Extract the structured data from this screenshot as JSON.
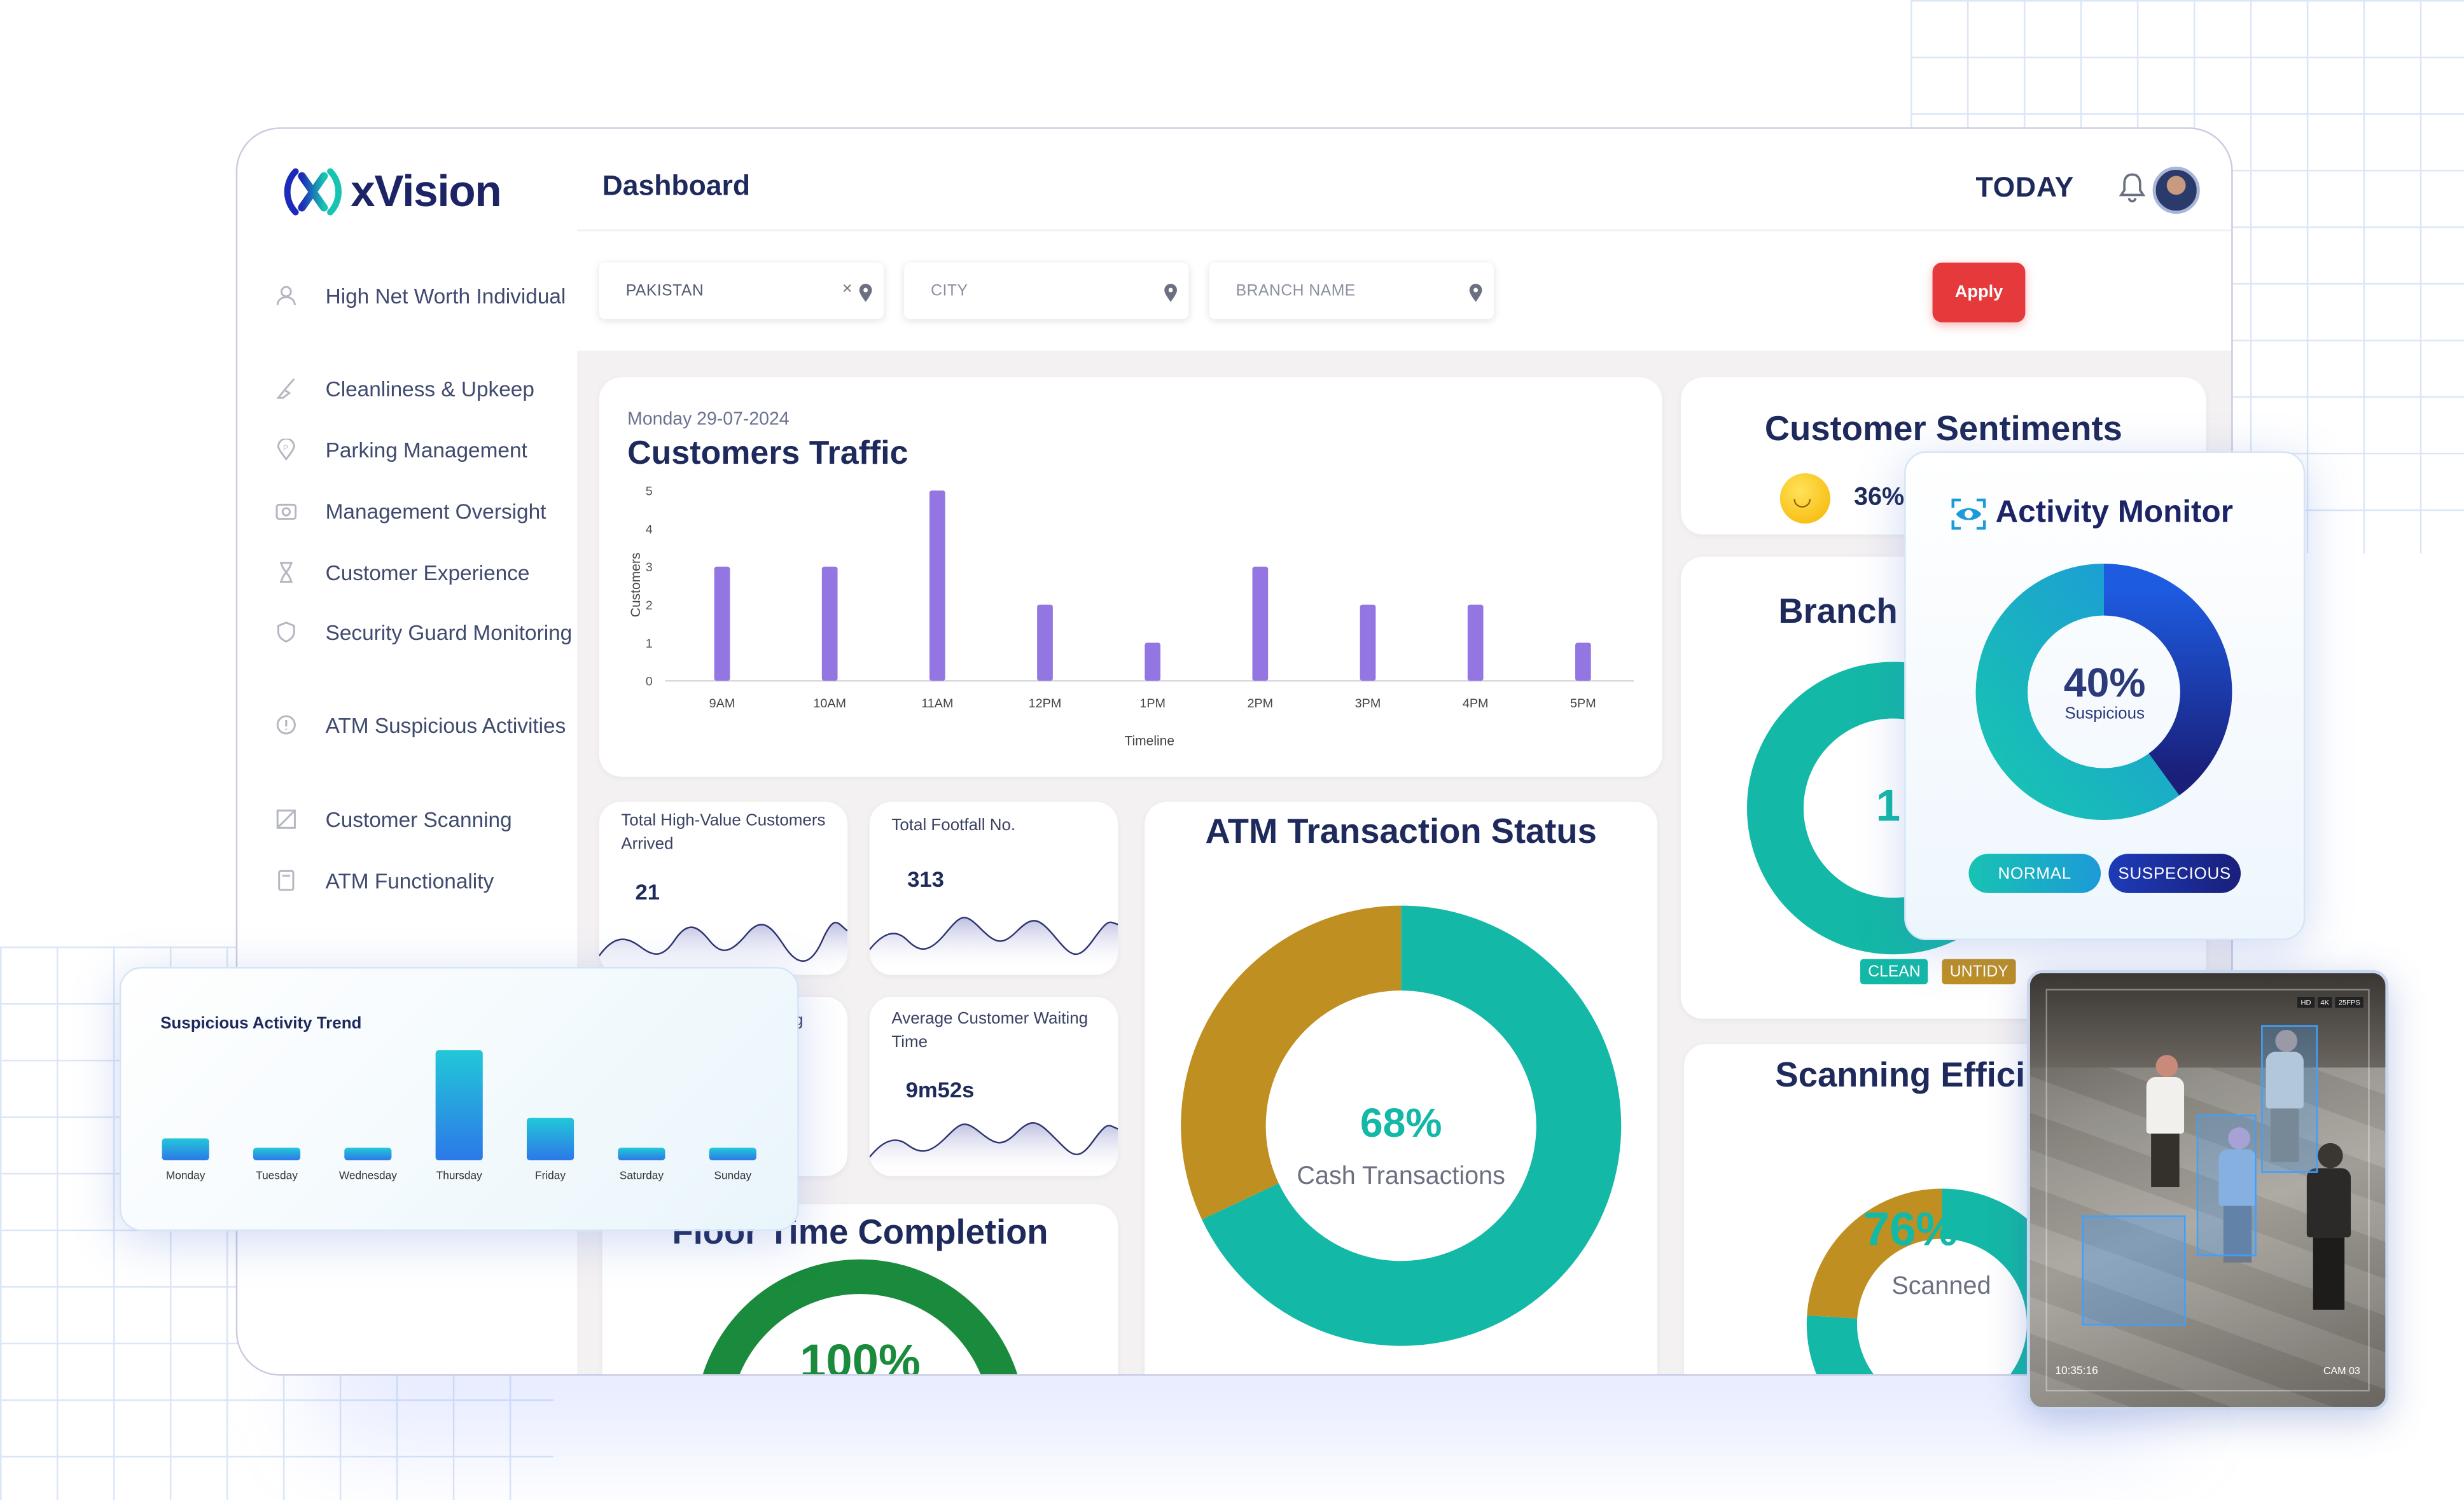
{
  "app": {
    "name": "xVision"
  },
  "sidebar": {
    "items": [
      {
        "label": "High Net Worth Individual",
        "icon": "user-icon"
      },
      {
        "label": "Cleanliness & Upkeep",
        "icon": "broom-icon"
      },
      {
        "label": "Parking Management",
        "icon": "parking-pin-icon"
      },
      {
        "label": "Management Oversight",
        "icon": "camera-icon"
      },
      {
        "label": "Customer Experience",
        "icon": "hourglass-icon"
      },
      {
        "label": "Security Guard Monitoring",
        "icon": "shield-icon"
      },
      {
        "label": "ATM Suspicious Activities",
        "icon": "alert-icon"
      },
      {
        "label": "Customer Scanning",
        "icon": "scan-icon"
      },
      {
        "label": "ATM Functionality",
        "icon": "atm-icon"
      }
    ]
  },
  "header": {
    "title": "Dashboard",
    "date_label": "TODAY",
    "icons": [
      "bell-icon",
      "avatar"
    ]
  },
  "filters": {
    "country": {
      "value": "PAKISTAN"
    },
    "city": {
      "placeholder": "CITY"
    },
    "branch": {
      "placeholder": "BRANCH NAME"
    },
    "apply_label": "Apply"
  },
  "traffic": {
    "date": "Monday 29-07-2024",
    "title": "Customers Traffic",
    "ylabel": "Customers",
    "xlabel": "Timeline"
  },
  "stats": {
    "high_value": {
      "label": "Total High-Value Customers Arrived",
      "value": "21"
    },
    "footfall": {
      "label": "Total Footfall No.",
      "value": "313"
    },
    "partial_label": "g",
    "waiting": {
      "label": "Average Customer Waiting Time",
      "value": "9m52s"
    }
  },
  "floor_time": {
    "title": "Floor Time Completion",
    "value": "100%"
  },
  "atm_status": {
    "title": "ATM Transaction Status",
    "value": "68%",
    "label": "Cash Transactions"
  },
  "sentiments": {
    "title": "Customer Sentiments",
    "value": "36%"
  },
  "branch": {
    "title": "Branch",
    "partial_value": "1",
    "tags": [
      "CLEAN",
      "UNTIDY"
    ]
  },
  "scanning": {
    "title": "Scanning Effici",
    "value": "76%",
    "label": "Scanned"
  },
  "activity_monitor": {
    "title": "Activity Monitor",
    "value": "40%",
    "label": "Suspicious",
    "buttons": [
      "NORMAL",
      "SUSPECIOUS"
    ]
  },
  "trend": {
    "title": "Suspicious Activity Trend"
  },
  "camera": {
    "time": "10:35:16",
    "cam": "CAM 03",
    "badges": [
      "HD",
      "4K",
      "25FPS"
    ]
  },
  "colors": {
    "teal": "#14b8a6",
    "gold": "#bf8f22",
    "navy": "#1f2a5c",
    "purple": "#9476e3",
    "red": "#e5393b",
    "green": "#1a8a3c"
  },
  "chart_data": [
    {
      "type": "bar",
      "title": "Customers Traffic",
      "xlabel": "Timeline",
      "ylabel": "Customers",
      "categories": [
        "9AM",
        "10AM",
        "11AM",
        "12PM",
        "1PM",
        "2PM",
        "3PM",
        "4PM",
        "5PM"
      ],
      "values": [
        3,
        3,
        5,
        2,
        1,
        3,
        2,
        2,
        1
      ],
      "ylim": [
        0,
        5
      ],
      "yticks": [
        0,
        1,
        2,
        3,
        4,
        5
      ],
      "grid": false
    },
    {
      "type": "bar",
      "title": "Suspicious Activity Trend",
      "categories": [
        "Monday",
        "Tuesday",
        "Wednesday",
        "Thursday",
        "Friday",
        "Saturday",
        "Sunday"
      ],
      "values": [
        14,
        8,
        8,
        70,
        27,
        8,
        8
      ],
      "ylim": [
        0,
        70
      ]
    },
    {
      "type": "pie",
      "title": "ATM Transaction Status",
      "labels": [
        "Cash Transactions",
        ""
      ],
      "values": [
        68,
        32
      ]
    },
    {
      "type": "pie",
      "title": "Activity Monitor",
      "labels": [
        "NORMAL",
        "SUSPECIOUS"
      ],
      "values": [
        60,
        40
      ]
    },
    {
      "type": "pie",
      "title": "Scanning Effici",
      "labels": [
        "Scanned",
        ""
      ],
      "values": [
        76,
        24
      ]
    },
    {
      "type": "pie",
      "title": "Floor Time Completion",
      "values": [
        100
      ]
    }
  ]
}
